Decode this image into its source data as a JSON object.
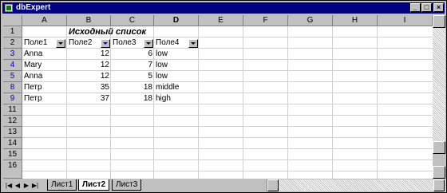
{
  "window": {
    "title": "dbExpert"
  },
  "titlebar_buttons": [
    {
      "glyph": "_"
    },
    {
      "glyph": "□"
    },
    {
      "glyph": "×"
    }
  ],
  "columns": [
    "A",
    "B",
    "C",
    "D",
    "E",
    "F",
    "G",
    "H",
    "I"
  ],
  "rows": [
    "1",
    "2",
    "3",
    "4",
    "5",
    "8",
    "9",
    "11",
    "12",
    "13",
    "14",
    "15",
    "16"
  ],
  "filtered_rows": [
    "3",
    "4",
    "5",
    "8",
    "9"
  ],
  "sheet": {
    "title": "Исходный список",
    "headers": [
      "Поле1",
      "Поле2",
      "Поле3",
      "Поле4"
    ],
    "data": [
      [
        "Anna",
        "12",
        "6",
        "low"
      ],
      [
        "Mary",
        "12",
        "7",
        "low"
      ],
      [
        "Anna",
        "12",
        "5",
        "low"
      ],
      [
        "Петр",
        "35",
        "18",
        "middle"
      ],
      [
        "Петр",
        "37",
        "18",
        "high"
      ]
    ]
  },
  "tabs": [
    "Лист1",
    "Лист2",
    "Лист3"
  ],
  "active_tab": "Лист2",
  "colors": {
    "titlebar": "#000080",
    "filtered_row_number": "#0000c0"
  }
}
